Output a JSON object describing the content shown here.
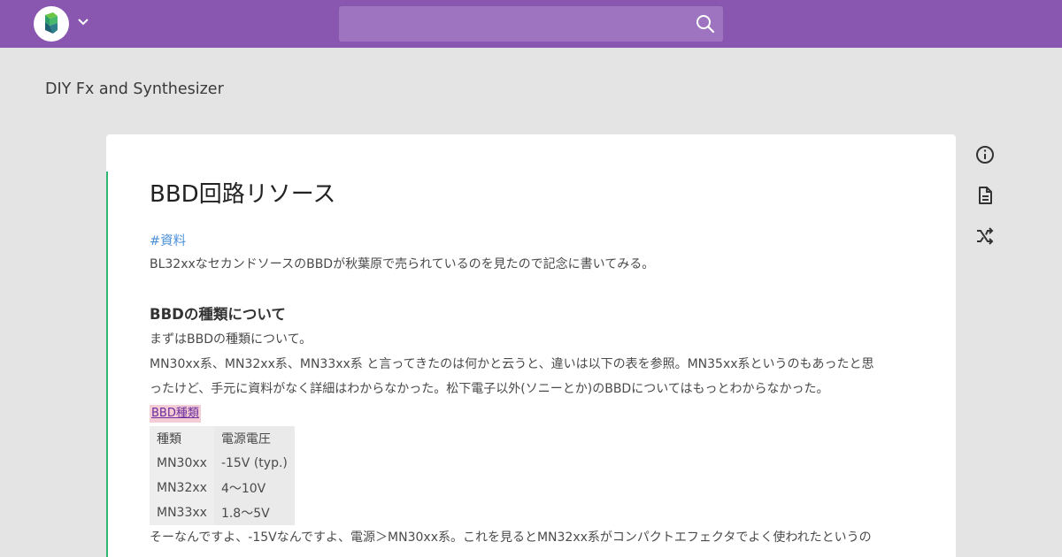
{
  "header": {
    "search": {
      "placeholder": "",
      "value": ""
    },
    "icons": {
      "logo": "service-logo",
      "menu": "chevron-down-icon",
      "search": "search-icon"
    },
    "colors": {
      "bar": "#8a57b0",
      "search_box": "#9e74c0"
    }
  },
  "blog": {
    "title": "DIY Fx and Synthesizer"
  },
  "article": {
    "title": "BBD回路リソース",
    "tag": "#資料",
    "intro": "BL32xxなセカンドソースのBBDが秋葉原で売られているのを見たので記念に書いてみる。",
    "section_heading": "BBDの種類について",
    "para1": "まずはBBDの種類について。",
    "para2_line1": "MN30xx系、MN32xx系、MN33xx系 と言ってきたのは何かと云うと、違いは以下の表を参照。MN35xx系というのもあったと思",
    "para2_line2": "ったけど、手元に資料がなく詳細はわからなかった。松下電子以外(ソニーとか)のBBDについてはもっとわからなかった。",
    "highlight_link": "BBD種類",
    "table": {
      "header": [
        "種類",
        "電源電圧"
      ],
      "rows": [
        [
          "MN30xx",
          "-15V (typ.)"
        ],
        [
          "MN32xx",
          "4～10V"
        ],
        [
          "MN33xx",
          "1.8～5V"
        ]
      ]
    },
    "para3": "そーなんですよ、-15Vなんですよ、電源＞MN30xx系。これを見るとMN32xx系がコンパクトエフェクタでよく使われたというの",
    "accent_color": "#2fb673"
  },
  "sidebar_icons": [
    "info-icon",
    "document-icon",
    "shuffle-icon"
  ]
}
